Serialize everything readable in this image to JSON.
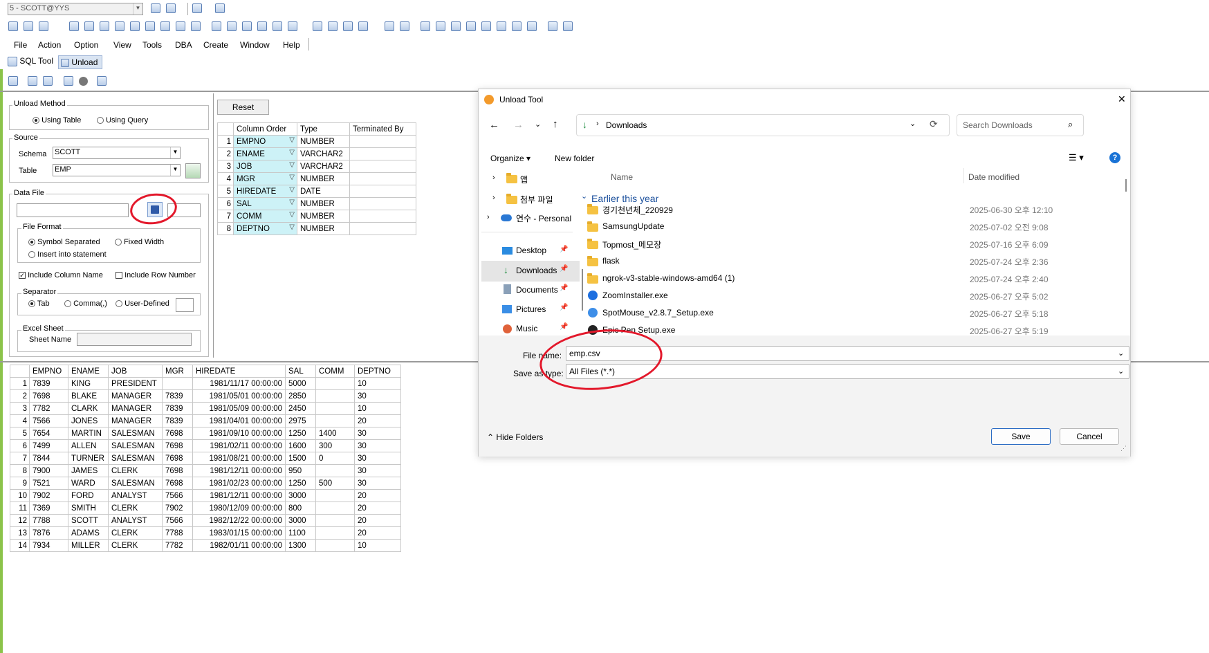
{
  "app": {
    "connection": "5 - SCOTT@YYS",
    "menu": [
      "File",
      "Action",
      "Option",
      "View",
      "Tools",
      "DBA",
      "Create",
      "Window",
      "Help"
    ],
    "tabs": [
      "SQL Tool",
      "Unload"
    ]
  },
  "unload": {
    "method_title": "Unload Method",
    "using_table": "Using Table",
    "using_query": "Using Query",
    "source_title": "Source",
    "schema_label": "Schema",
    "schema_value": "SCOTT",
    "table_label": "Table",
    "table_value": "EMP",
    "datafile_title": "Data File",
    "file_format_title": "File Format",
    "symbol_separated": "Symbol Separated",
    "fixed_width": "Fixed Width",
    "insert_into": "Insert into statement",
    "include_column_name": "Include Column Name",
    "include_row_number": "Include Row Number",
    "separator_title": "Separator",
    "sep_tab": "Tab",
    "sep_comma": "Comma(,)",
    "sep_user": "User-Defined",
    "excel_title": "Excel Sheet",
    "sheet_name_label": "Sheet Name",
    "reset_label": "Reset"
  },
  "columns_table": {
    "headers": [
      "Column Order",
      "Type",
      "Terminated By"
    ],
    "rows": [
      [
        "1",
        "EMPNO",
        "NUMBER"
      ],
      [
        "2",
        "ENAME",
        "VARCHAR2"
      ],
      [
        "3",
        "JOB",
        "VARCHAR2"
      ],
      [
        "4",
        "MGR",
        "NUMBER"
      ],
      [
        "5",
        "HIREDATE",
        "DATE"
      ],
      [
        "6",
        "SAL",
        "NUMBER"
      ],
      [
        "7",
        "COMM",
        "NUMBER"
      ],
      [
        "8",
        "DEPTNO",
        "NUMBER"
      ]
    ]
  },
  "data_table": {
    "headers": [
      "EMPNO",
      "ENAME",
      "JOB",
      "MGR",
      "HIREDATE",
      "SAL",
      "COMM",
      "DEPTNO"
    ],
    "rows": [
      [
        "1",
        "7839",
        "KING",
        "PRESIDENT",
        "",
        "1981/11/17 00:00:00",
        "5000",
        "",
        "10"
      ],
      [
        "2",
        "7698",
        "BLAKE",
        "MANAGER",
        "7839",
        "1981/05/01 00:00:00",
        "2850",
        "",
        "30"
      ],
      [
        "3",
        "7782",
        "CLARK",
        "MANAGER",
        "7839",
        "1981/05/09 00:00:00",
        "2450",
        "",
        "10"
      ],
      [
        "4",
        "7566",
        "JONES",
        "MANAGER",
        "7839",
        "1981/04/01 00:00:00",
        "2975",
        "",
        "20"
      ],
      [
        "5",
        "7654",
        "MARTIN",
        "SALESMAN",
        "7698",
        "1981/09/10 00:00:00",
        "1250",
        "1400",
        "30"
      ],
      [
        "6",
        "7499",
        "ALLEN",
        "SALESMAN",
        "7698",
        "1981/02/11 00:00:00",
        "1600",
        "300",
        "30"
      ],
      [
        "7",
        "7844",
        "TURNER",
        "SALESMAN",
        "7698",
        "1981/08/21 00:00:00",
        "1500",
        "0",
        "30"
      ],
      [
        "8",
        "7900",
        "JAMES",
        "CLERK",
        "7698",
        "1981/12/11 00:00:00",
        "950",
        "",
        "30"
      ],
      [
        "9",
        "7521",
        "WARD",
        "SALESMAN",
        "7698",
        "1981/02/23 00:00:00",
        "1250",
        "500",
        "30"
      ],
      [
        "10",
        "7902",
        "FORD",
        "ANALYST",
        "7566",
        "1981/12/11 00:00:00",
        "3000",
        "",
        "20"
      ],
      [
        "11",
        "7369",
        "SMITH",
        "CLERK",
        "7902",
        "1980/12/09 00:00:00",
        "800",
        "",
        "20"
      ],
      [
        "12",
        "7788",
        "SCOTT",
        "ANALYST",
        "7566",
        "1982/12/22 00:00:00",
        "3000",
        "",
        "20"
      ],
      [
        "13",
        "7876",
        "ADAMS",
        "CLERK",
        "7788",
        "1983/01/15 00:00:00",
        "1100",
        "",
        "20"
      ],
      [
        "14",
        "7934",
        "MILLER",
        "CLERK",
        "7782",
        "1982/01/11 00:00:00",
        "1300",
        "",
        "10"
      ]
    ]
  },
  "dialog": {
    "title": "Unload Tool",
    "close": "✕",
    "path": "Downloads",
    "search_placeholder": "Search Downloads",
    "organize": "Organize",
    "new_folder": "New folder",
    "col_name": "Name",
    "col_date": "Date modified",
    "group_label": "Earlier this year",
    "nav": [
      "앱",
      "첨부 파일",
      "연수 - Personal",
      "Desktop",
      "Downloads",
      "Documents",
      "Pictures",
      "Music"
    ],
    "files": [
      {
        "name": "경기천년체_220929",
        "date": "2025-06-30 오후 12:10",
        "icon": "folder-icon"
      },
      {
        "name": "SamsungUpdate",
        "date": "2025-07-02 오전 9:08",
        "icon": "folder-icon"
      },
      {
        "name": "Topmost_메모장",
        "date": "2025-07-16 오후 6:09",
        "icon": "folder-icon"
      },
      {
        "name": "flask",
        "date": "2025-07-24 오후 2:36",
        "icon": "folder-icon"
      },
      {
        "name": "ngrok-v3-stable-windows-amd64 (1)",
        "date": "2025-07-24 오후 2:40",
        "icon": "folder-icon"
      },
      {
        "name": "ZoomInstaller.exe",
        "date": "2025-06-27 오후 5:02",
        "icon": "zoom-icon"
      },
      {
        "name": "SpotMouse_v2.8.7_Setup.exe",
        "date": "2025-06-27 오후 5:18",
        "icon": "spotmouse-icon"
      },
      {
        "name": "Epic Pen Setup.exe",
        "date": "2025-06-27 오후 5:19",
        "icon": "epicpen-icon"
      }
    ],
    "file_name_label": "File name:",
    "file_name_value": "emp.csv",
    "save_type_label": "Save as type:",
    "save_type_value": "All Files (*.*)",
    "hide_folders": "Hide Folders",
    "save": "Save",
    "cancel": "Cancel"
  }
}
